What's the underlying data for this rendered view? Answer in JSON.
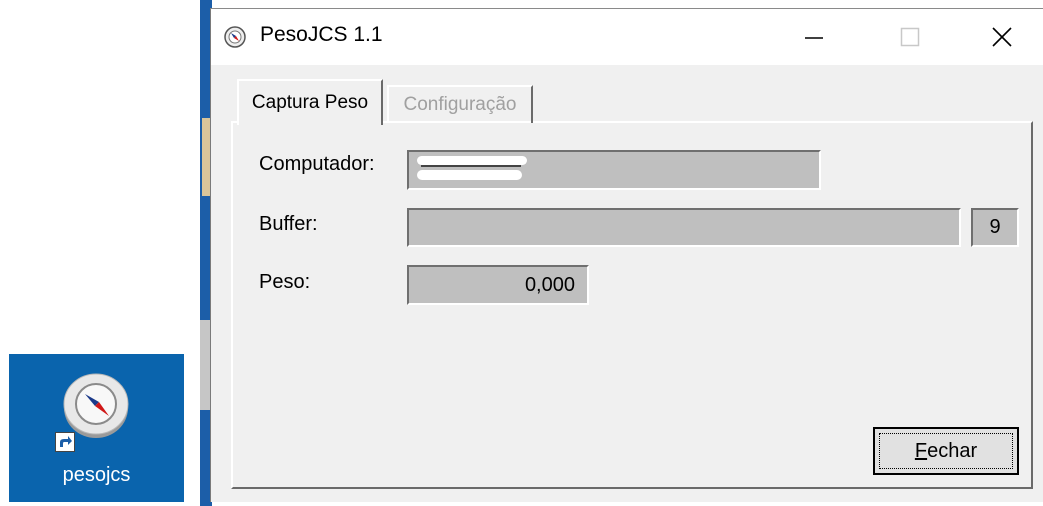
{
  "desktop": {
    "icon_label": "pesojcs",
    "icon_name": "compass-icon"
  },
  "window": {
    "title": "PesoJCS 1.1",
    "app_icon": "compass-icon",
    "controls": {
      "minimize": "minimize-icon",
      "maximize": "maximize-icon",
      "close": "close-icon"
    }
  },
  "tabs": [
    {
      "label": "Captura Peso",
      "active": true
    },
    {
      "label": "Configuração",
      "active": false
    }
  ],
  "form": {
    "computador_label": "Computador:",
    "buffer_label": "Buffer:",
    "buffer_value": "",
    "buffer_count": "9",
    "peso_label": "Peso:",
    "peso_value": "0,000"
  },
  "buttons": {
    "fechar_rest": "echar",
    "fechar_accel": "F"
  },
  "colors": {
    "desktop_blue": "#0a64ad",
    "field_gray": "#bfbfbf",
    "window_bg": "#f0f0f0"
  }
}
